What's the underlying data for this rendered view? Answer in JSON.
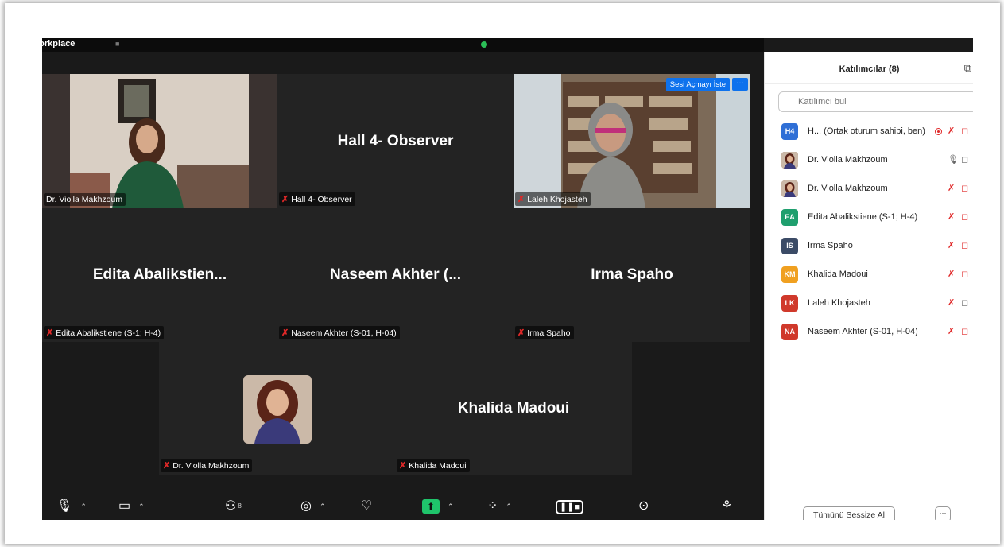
{
  "window": {
    "app_name": "Workplace"
  },
  "gallery": {
    "tiles": [
      {
        "name_tag": "Dr. Violla Makhzoum"
      },
      {
        "big_name": "Hall 4- Observer",
        "name_tag": "Hall 4- Observer"
      },
      {
        "name_tag": "Laleh Khojasteh",
        "unmute_label": "Sesi Açmayı İste",
        "more_label": "···"
      },
      {
        "big_name": "Edita  Abalikstien...",
        "name_tag": "Edita Abalikstiene  (S-1; H-4)"
      },
      {
        "big_name": "Naseem  Akhter  (...",
        "name_tag": "Naseem Akhter (S-01, H-04)"
      },
      {
        "big_name": "Irma Spaho",
        "name_tag": "Irma Spaho"
      },
      {
        "name_tag": "Dr. Violla Makhzoum"
      },
      {
        "big_name": "Khalida Madoui",
        "name_tag": "Khalida Madoui"
      }
    ]
  },
  "toolbar": {
    "participants_count": "8",
    "icons": [
      "mic-muted-icon",
      "video-off-icon",
      "participants-icon",
      "chat-icon",
      "reactions-icon",
      "share-screen-icon",
      "apps-icon",
      "record-icon",
      "more-icon",
      "breakout-icon"
    ]
  },
  "participants_panel": {
    "title": "Katılımcılar (8)",
    "search_placeholder": "Katılımcı bul",
    "mute_all_label": "Tümünü Sessize Al",
    "more_label": "···",
    "items": [
      {
        "initials": "H4",
        "name": "H... (Ortak oturum sahibi, ben)",
        "color": "#2f6fd6",
        "mic": "muted",
        "video": "off",
        "recording": true
      },
      {
        "initials": "",
        "name": "Dr. Violla Makhzoum",
        "color": "#7a4a32",
        "mic": "on",
        "video": "on",
        "photo": true
      },
      {
        "initials": "",
        "name": "Dr. Violla Makhzoum",
        "color": "#8a5a3a",
        "mic": "muted",
        "video": "off",
        "photo": true
      },
      {
        "initials": "EA",
        "name": "Edita Abalikstiene  (S-1; H-4)",
        "color": "#1f9f6e",
        "mic": "muted",
        "video": "off"
      },
      {
        "initials": "IS",
        "name": "Irma Spaho",
        "color": "#3b4b66",
        "mic": "muted",
        "video": "off"
      },
      {
        "initials": "KM",
        "name": "Khalida Madoui",
        "color": "#f0a020",
        "mic": "muted",
        "video": "off"
      },
      {
        "initials": "LK",
        "name": "Laleh Khojasteh",
        "color": "#d0392b",
        "mic": "muted",
        "video": "on"
      },
      {
        "initials": "NA",
        "name": "Naseem Akhter (S-01, H-04)",
        "color": "#d0392b",
        "mic": "muted",
        "video": "off"
      }
    ]
  },
  "colors": {
    "active_speaker": "#2ee59d",
    "accent_blue": "#0e72ed",
    "muted_red": "#e02828",
    "share_green": "#1fc46b"
  }
}
